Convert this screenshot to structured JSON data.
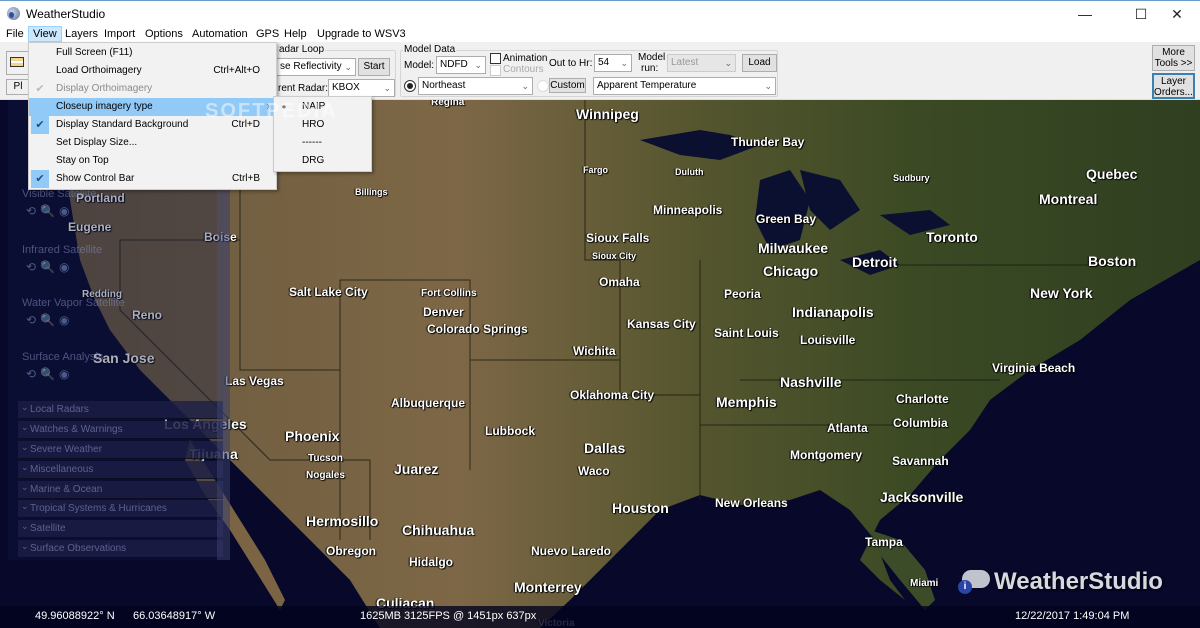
{
  "window": {
    "title": "WeatherStudio",
    "minimize": "—",
    "maximize": "☐",
    "close": "✕"
  },
  "menubar": [
    "File",
    "View",
    "Layers",
    "Import",
    "Options",
    "Automation",
    "GPS",
    "Help",
    "Upgrade to WSV3"
  ],
  "toolbar": {
    "play_label": "Pl",
    "radar_loop": {
      "group_label": "adar Loop",
      "product": "se Reflectivity",
      "start_label": "Start",
      "radar_label": "rent Radar:",
      "radar_value": "KBOX"
    },
    "model_data": {
      "group_label": "Model Data",
      "model_label": "Model:",
      "model_value": "NDFD",
      "animation_label": "Animation",
      "animation_checked": false,
      "contours_label": "Contours",
      "contours_checked": false,
      "out_to_hr_label": "Out to Hr:",
      "out_to_hr_value": "54",
      "model_run_label_1": "Model",
      "model_run_label_2": "run:",
      "model_run_value": "Latest",
      "load_label": "Load",
      "region_value": "Northeast",
      "region_selected": true,
      "custom_label": "Custom",
      "variable_value": "Apparent Temperature"
    },
    "more_tools_1": "More",
    "more_tools_2": "Tools >>",
    "layer_orders_1": "Layer",
    "layer_orders_2": "Orders..."
  },
  "view_menu": {
    "items": [
      {
        "label": "Full Screen  (F11)",
        "shortcut": "",
        "checked": false,
        "disabled": false
      },
      {
        "label": "Load Orthoimagery",
        "shortcut": "Ctrl+Alt+O",
        "checked": false,
        "disabled": false
      },
      {
        "label": "Display Orthoimagery",
        "shortcut": "",
        "checked": true,
        "disabled": true
      },
      {
        "label": "Closeup imagery type",
        "shortcut": "",
        "submenu": "›",
        "highlighted": true
      },
      {
        "label": "Display Standard Background",
        "shortcut": "Ctrl+D",
        "checked": true,
        "disabled": false
      },
      {
        "label": "Set Display Size...",
        "shortcut": "",
        "checked": false,
        "disabled": false
      },
      {
        "label": "Stay on Top",
        "shortcut": "",
        "checked": false,
        "disabled": false
      },
      {
        "label": "Show Control Bar",
        "shortcut": "Ctrl+B",
        "checked": true,
        "disabled": false
      }
    ],
    "check_glyph": "✔"
  },
  "closeup_submenu": {
    "items": [
      {
        "label": "NAIP",
        "selected": true
      },
      {
        "label": "HRO",
        "selected": false
      },
      {
        "label": "------",
        "selected": false
      },
      {
        "label": "DRG",
        "selected": false
      }
    ],
    "bullet": "•"
  },
  "side_panel": {
    "sections": [
      "Visible Satellite",
      "Infrared Satellite",
      "Water Vapor Satellite",
      "Surface Analysis"
    ],
    "section_icons": "⟲🔍◉",
    "categories": [
      "Local Radars",
      "Watches & Warnings",
      "Severe Weather",
      "Miscellaneous",
      "Marine & Ocean",
      "Tropical Systems & Hurricanes",
      "Satellite",
      "Surface Observations"
    ]
  },
  "map": {
    "cities": [
      {
        "name": "Regina",
        "size": "sm"
      },
      {
        "name": "Winnipeg",
        "size": "lg"
      },
      {
        "name": "Thunder Bay",
        "size": "md"
      },
      {
        "name": "Fargo",
        "size": "xs"
      },
      {
        "name": "Duluth",
        "size": "xs"
      },
      {
        "name": "Sudbury",
        "size": "xs"
      },
      {
        "name": "Quebec",
        "size": "lg"
      },
      {
        "name": "Montreal",
        "size": "lg"
      },
      {
        "name": "Billings",
        "size": "xs"
      },
      {
        "name": "Portland",
        "size": "md"
      },
      {
        "name": "Minneapolis",
        "size": "md"
      },
      {
        "name": "Green Bay",
        "size": "md"
      },
      {
        "name": "Eugene",
        "size": "md"
      },
      {
        "name": "Boise",
        "size": "md"
      },
      {
        "name": "Sioux Falls",
        "size": "md"
      },
      {
        "name": "Milwaukee",
        "size": "lg"
      },
      {
        "name": "Toronto",
        "size": "lg"
      },
      {
        "name": "Sioux City",
        "size": "xs"
      },
      {
        "name": "Chicago",
        "size": "lg"
      },
      {
        "name": "Detroit",
        "size": "lg"
      },
      {
        "name": "Boston",
        "size": "lg"
      },
      {
        "name": "Omaha",
        "size": "md"
      },
      {
        "name": "Redding",
        "size": "sm"
      },
      {
        "name": "Salt Lake City",
        "size": "md"
      },
      {
        "name": "Fort Collins",
        "size": "sm"
      },
      {
        "name": "Peoria",
        "size": "md"
      },
      {
        "name": "New York",
        "size": "lg"
      },
      {
        "name": "Denver",
        "size": "md"
      },
      {
        "name": "Reno",
        "size": "md"
      },
      {
        "name": "Indianapolis",
        "size": "lg"
      },
      {
        "name": "Kansas City",
        "size": "md"
      },
      {
        "name": "Colorado Springs",
        "size": "md"
      },
      {
        "name": "Saint Louis",
        "size": "md"
      },
      {
        "name": "Louisville",
        "size": "md"
      },
      {
        "name": "Wichita",
        "size": "md"
      },
      {
        "name": "San Jose",
        "size": "lg"
      },
      {
        "name": "Virginia Beach",
        "size": "md"
      },
      {
        "name": "Las Vegas",
        "size": "md"
      },
      {
        "name": "Nashville",
        "size": "lg"
      },
      {
        "name": "Oklahoma City",
        "size": "md"
      },
      {
        "name": "Charlotte",
        "size": "md"
      },
      {
        "name": "Albuquerque",
        "size": "md"
      },
      {
        "name": "Memphis",
        "size": "lg"
      },
      {
        "name": "Los Angeles",
        "size": "lg"
      },
      {
        "name": "Atlanta",
        "size": "md"
      },
      {
        "name": "Columbia",
        "size": "md"
      },
      {
        "name": "Lubbock",
        "size": "md"
      },
      {
        "name": "Phoenix",
        "size": "lg"
      },
      {
        "name": "Dallas",
        "size": "lg"
      },
      {
        "name": "Tijuana",
        "size": "lg"
      },
      {
        "name": "Montgomery",
        "size": "md"
      },
      {
        "name": "Savannah",
        "size": "md"
      },
      {
        "name": "Tucson",
        "size": "sm"
      },
      {
        "name": "Juarez",
        "size": "lg"
      },
      {
        "name": "Waco",
        "size": "md"
      },
      {
        "name": "Nogales",
        "size": "sm"
      },
      {
        "name": "Jacksonville",
        "size": "lg"
      },
      {
        "name": "New Orleans",
        "size": "md"
      },
      {
        "name": "Houston",
        "size": "lg"
      },
      {
        "name": "Hermosillo",
        "size": "lg"
      },
      {
        "name": "Chihuahua",
        "size": "lg"
      },
      {
        "name": "Tampa",
        "size": "md"
      },
      {
        "name": "Obregon",
        "size": "md"
      },
      {
        "name": "Nuevo Laredo",
        "size": "md"
      },
      {
        "name": "Hidalgo",
        "size": "md"
      },
      {
        "name": "Miami",
        "size": "sm"
      },
      {
        "name": "Monterrey",
        "size": "lg"
      },
      {
        "name": "Culiacan",
        "size": "lg"
      },
      {
        "name": "Victoria",
        "size": "sm"
      }
    ]
  },
  "watermark": "SOFTPEDIA",
  "logo": {
    "text": "WeatherStudio"
  },
  "status": {
    "lat": "49.96088922° N",
    "lon": "66.03648917° W",
    "perf": "1625MB 3125FPS @ 1451px 637px",
    "datetime": "12/22/2017 1:49:04 PM"
  }
}
